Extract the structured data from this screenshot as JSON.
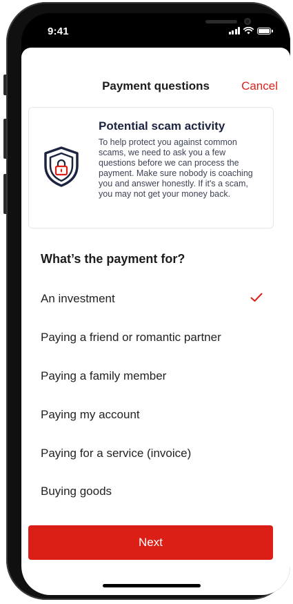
{
  "status_bar": {
    "time": "9:41"
  },
  "header": {
    "title": "Payment questions",
    "cancel_label": "Cancel"
  },
  "warning": {
    "title": "Potential scam activity",
    "body": "To help protect you against common scams, we need to ask you a few questions before we can process the payment. Make sure nobody is coaching you and answer honestly. If it's a scam, you may not get your money back."
  },
  "question": "What’s the payment for?",
  "options": [
    {
      "label": "An investment",
      "selected": true
    },
    {
      "label": "Paying a friend or romantic partner",
      "selected": false
    },
    {
      "label": "Paying a family member",
      "selected": false
    },
    {
      "label": "Paying my account",
      "selected": false
    },
    {
      "label": "Paying for a service (invoice)",
      "selected": false
    },
    {
      "label": "Buying goods",
      "selected": false
    }
  ],
  "next_label": "Next",
  "colors": {
    "accent": "#db1f16",
    "shield": "#1d2440"
  }
}
